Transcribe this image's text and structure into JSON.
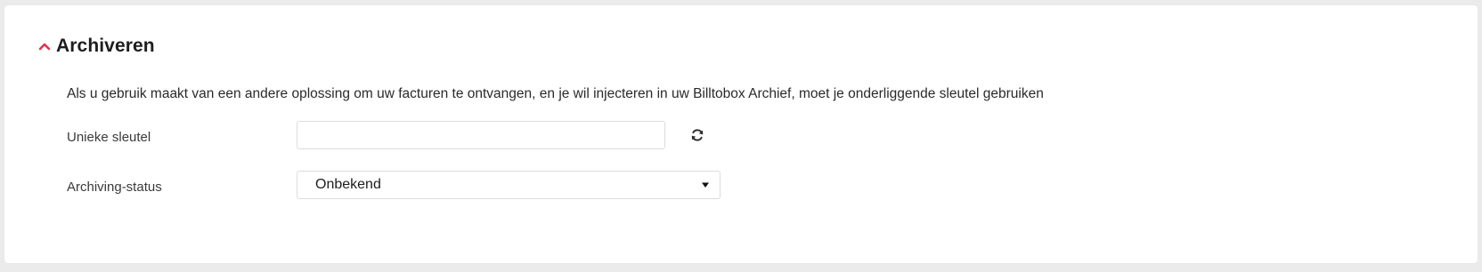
{
  "section": {
    "title": "Archiveren",
    "expanded": true,
    "chevron_icon": "chevron-up-icon",
    "accent_color": "#e0344f"
  },
  "description": "Als u gebruik maakt van een andere oplossing om uw facturen te ontvangen, en je wil injecteren in uw Billtobox Archief, moet je onderliggende sleutel gebruiken",
  "form": {
    "key": {
      "label": "Unieke sleutel",
      "value": "",
      "refresh_icon": "refresh-icon"
    },
    "status": {
      "label": "Archiving-status",
      "selected": "Onbekend",
      "caret_icon": "caret-down-icon"
    }
  }
}
